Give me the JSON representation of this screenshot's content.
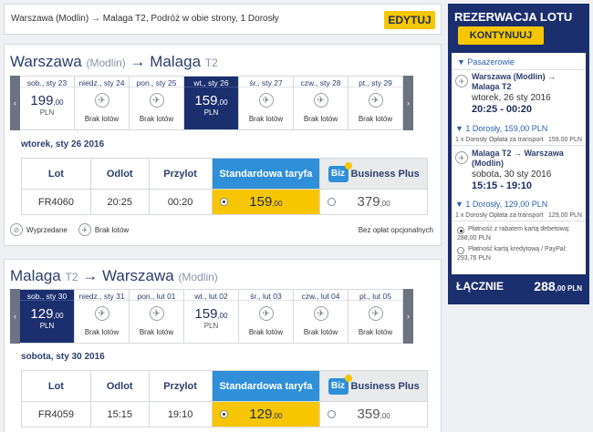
{
  "search": {
    "summary": "Warszawa (Modlin) → Malaga T2, Podróż w obie strony, 1 Dorosły",
    "edit_label": "EDYTUJ"
  },
  "outbound": {
    "title_from": "Warszawa",
    "title_from_sub": "(Modlin)",
    "arrow": "→",
    "title_to": "Malaga",
    "title_to_sub": "T2",
    "days": [
      {
        "label": "sob., sty 23",
        "price": "199",
        "dec": ",00",
        "cur": "PLN"
      },
      {
        "label": "niedz., sty 24",
        "nf": "Brak lotów"
      },
      {
        "label": "pon., sty 25",
        "nf": "Brak lotów"
      },
      {
        "label": "wt., sty 26",
        "price": "159",
        "dec": ",00",
        "cur": "PLN",
        "selected": true
      },
      {
        "label": "śr., sty 27",
        "nf": "Brak lotów"
      },
      {
        "label": "czw., sty 28",
        "nf": "Brak lotów"
      },
      {
        "label": "pt., sty 29",
        "nf": "Brak lotów"
      }
    ],
    "date_heading": "wtorek, sty 26 2016",
    "headers": {
      "lot": "Lot",
      "odlot": "Odlot",
      "przylot": "Przylot",
      "std": "Standardowa taryfa",
      "biz_logo": "Biz",
      "biz": "Business Plus"
    },
    "row": {
      "flight": "FR4060",
      "dep": "20:25",
      "arr": "00:20",
      "std_price": "159",
      "std_dec": ",00",
      "biz_price": "379",
      "biz_dec": ",00"
    }
  },
  "legend": {
    "sold": "Wyprzedane",
    "none": "Brak lotów",
    "fees": "Bez opłat opcjonalnych"
  },
  "inbound": {
    "title_from": "Malaga",
    "title_from_sub": "T2",
    "arrow": "→",
    "title_to": "Warszawa",
    "title_to_sub": "(Modlin)",
    "days": [
      {
        "label": "sob., sty 30",
        "price": "129",
        "dec": ",00",
        "cur": "PLN",
        "selected": true
      },
      {
        "label": "niedz., sty 31",
        "nf": "Brak lotów"
      },
      {
        "label": "pon., lut 01",
        "nf": "Brak lotów"
      },
      {
        "label": "wt., lut 02",
        "price": "159",
        "dec": ",00",
        "cur": "PLN"
      },
      {
        "label": "śr., lut 03",
        "nf": "Brak lotów"
      },
      {
        "label": "czw., lut 04",
        "nf": "Brak lotów"
      },
      {
        "label": "pt., lut 05",
        "nf": "Brak lotów"
      }
    ],
    "date_heading": "sobota, sty 30 2016",
    "headers": {
      "lot": "Lot",
      "odlot": "Odlot",
      "przylot": "Przylot",
      "std": "Standardowa taryfa",
      "biz_logo": "Biz",
      "biz": "Business Plus"
    },
    "row": {
      "flight": "FR4059",
      "dep": "15:15",
      "arr": "19:10",
      "std_price": "129",
      "std_dec": ",00",
      "biz_price": "359",
      "biz_dec": ",00"
    }
  },
  "sidebar": {
    "title": "REZERWACJA LOTU",
    "continue": "KONTYNUUJ",
    "passengers": "▼ Pasażerowie",
    "leg1": {
      "route": "Warszawa (Modlin) → Malaga T2",
      "date": "wtorek, 26 sty 2016",
      "time": "20:25 - 00:20",
      "pax": "▼ 1 Dorosły, 159,00 PLN",
      "fee_label": "1 x Dorosły Opłata za transport",
      "fee": "159,00 PLN"
    },
    "leg2": {
      "route": "Malaga T2 → Warszawa (Modlin)",
      "date": "sobota, 30 sty 2016",
      "time": "15:15 - 19:10",
      "pax": "▼ 1 Dorosły, 129,00 PLN",
      "fee_label": "1 x Dorosły Opłata za transport",
      "fee": "129,00 PLN"
    },
    "pay1": "Płatność z rabatem kartą debetową:",
    "pay1_amount": "288,00 PLN",
    "pay2": "Płatność kartą kredytową / PayPal:",
    "pay2_amount": "293,76 PLN",
    "total_label": "ŁĄCZNIE",
    "total": "288",
    "total_dec": ",00 PLN"
  }
}
